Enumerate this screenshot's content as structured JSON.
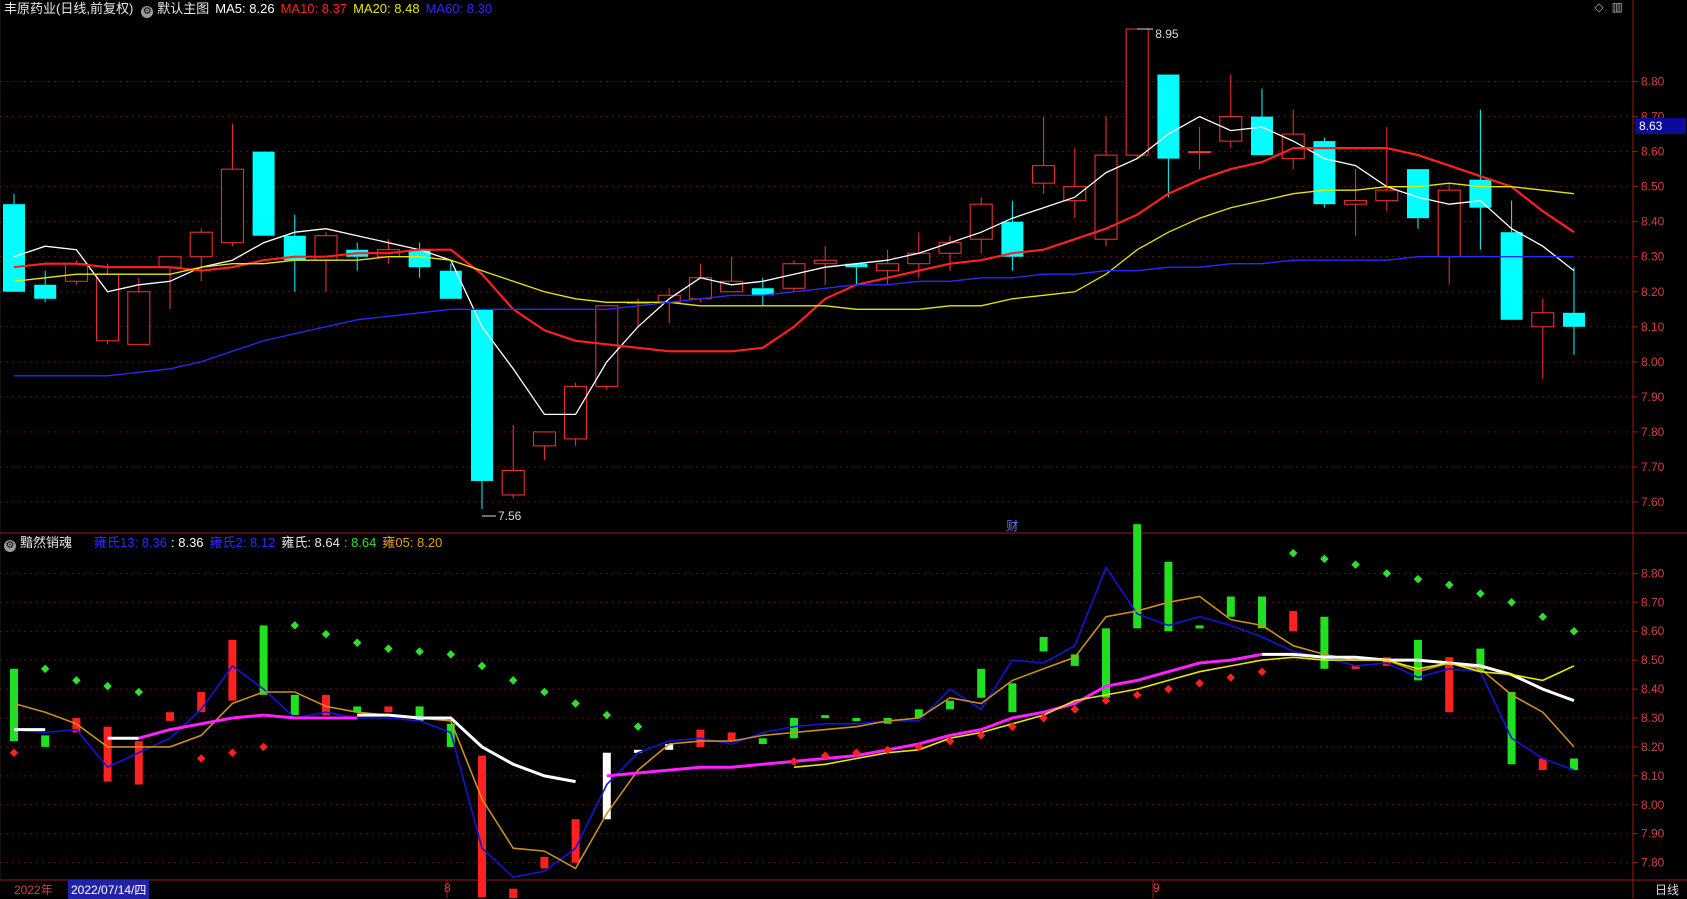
{
  "main_header": {
    "stock": "丰原药业(日线,前复权)",
    "chart_name": "默认主图",
    "ma5": "MA5: 8.26",
    "ma10": "MA10: 8.37",
    "ma20": "MA20: 8.48",
    "ma60": "MA60: 8.30",
    "colors": {
      "ma5": "#ffffff",
      "ma10": "#ff2020",
      "ma20": "#e6e600",
      "ma60": "#2a2aff"
    }
  },
  "sub_header": {
    "name": "黯然销魂",
    "l1": "雍氏13: 8.36",
    "l2": ": 8.36",
    "l3": "雍氏2: 8.12",
    "l4": "雍氏: 8.64",
    "l5": ": 8.64",
    "l6": "雍05: 8.20"
  },
  "current_price": "8.63",
  "fin_marker": "财",
  "bottom": {
    "year": "2022年",
    "date": "2022/07/14/四",
    "months": [
      "8",
      "9"
    ],
    "period": "日线"
  },
  "chart_data": [
    {
      "type": "candlestick",
      "title": "默认主图",
      "ylim": [
        7.52,
        8.97
      ],
      "y_ticks": [
        "8.80",
        "8.70",
        "8.60",
        "8.50",
        "8.40",
        "8.30",
        "8.20",
        "8.10",
        "8.00",
        "7.90",
        "7.80",
        "7.70",
        "7.60"
      ],
      "annotations": {
        "high": "8.95",
        "low": "7.56"
      },
      "candles": [
        [
          8.45,
          8.48,
          8.2,
          8.2
        ],
        [
          8.22,
          8.26,
          8.17,
          8.18
        ],
        [
          8.23,
          8.29,
          8.22,
          8.28
        ],
        [
          8.06,
          8.28,
          8.05,
          8.25
        ],
        [
          8.05,
          8.24,
          8.05,
          8.2
        ],
        [
          8.27,
          8.3,
          8.15,
          8.3
        ],
        [
          8.3,
          8.38,
          8.23,
          8.37
        ],
        [
          8.34,
          8.68,
          8.33,
          8.55
        ],
        [
          8.6,
          8.6,
          8.36,
          8.36
        ],
        [
          8.36,
          8.42,
          8.2,
          8.29
        ],
        [
          8.29,
          8.37,
          8.2,
          8.36
        ],
        [
          8.32,
          8.34,
          8.26,
          8.3
        ],
        [
          8.3,
          8.35,
          8.28,
          8.32
        ],
        [
          8.32,
          8.34,
          8.24,
          8.27
        ],
        [
          8.26,
          8.28,
          8.18,
          8.18
        ],
        [
          8.15,
          8.15,
          7.58,
          7.66
        ],
        [
          7.62,
          7.82,
          7.61,
          7.69
        ],
        [
          7.76,
          7.8,
          7.72,
          7.8
        ],
        [
          7.78,
          7.94,
          7.76,
          7.93
        ],
        [
          7.93,
          8.16,
          7.92,
          8.16
        ],
        [
          8.17,
          8.18,
          8.1,
          8.17
        ],
        [
          8.17,
          8.21,
          8.11,
          8.19
        ],
        [
          8.18,
          8.28,
          8.17,
          8.24
        ],
        [
          8.2,
          8.3,
          8.2,
          8.23
        ],
        [
          8.21,
          8.24,
          8.16,
          8.19
        ],
        [
          8.21,
          8.29,
          8.2,
          8.28
        ],
        [
          8.28,
          8.33,
          8.22,
          8.29
        ],
        [
          8.28,
          8.27,
          8.22,
          8.27
        ],
        [
          8.26,
          8.32,
          8.22,
          8.28
        ],
        [
          8.28,
          8.37,
          8.24,
          8.31
        ],
        [
          8.31,
          8.36,
          8.26,
          8.34
        ],
        [
          8.35,
          8.47,
          8.31,
          8.45
        ],
        [
          8.4,
          8.46,
          8.26,
          8.3
        ],
        [
          8.51,
          8.7,
          8.48,
          8.56
        ],
        [
          8.46,
          8.61,
          8.41,
          8.5
        ],
        [
          8.35,
          8.7,
          8.33,
          8.59
        ],
        [
          8.59,
          8.95,
          8.58,
          8.95
        ],
        [
          8.82,
          8.82,
          8.47,
          8.58
        ],
        [
          8.6,
          8.67,
          8.55,
          8.6
        ],
        [
          8.63,
          8.82,
          8.61,
          8.7
        ],
        [
          8.7,
          8.78,
          8.6,
          8.59
        ],
        [
          8.58,
          8.72,
          8.55,
          8.65
        ],
        [
          8.63,
          8.64,
          8.44,
          8.45
        ],
        [
          8.45,
          8.55,
          8.36,
          8.46
        ],
        [
          8.46,
          8.67,
          8.43,
          8.49
        ],
        [
          8.55,
          8.55,
          8.38,
          8.41
        ],
        [
          8.3,
          8.51,
          8.22,
          8.49
        ],
        [
          8.52,
          8.72,
          8.32,
          8.44
        ],
        [
          8.37,
          8.46,
          8.12,
          8.12
        ],
        [
          8.1,
          8.18,
          7.95,
          8.14
        ],
        [
          8.14,
          8.27,
          8.02,
          8.1
        ]
      ],
      "series": [
        {
          "name": "MA5",
          "color": "#ffffff",
          "values": [
            8.3,
            8.33,
            8.32,
            8.2,
            8.22,
            8.23,
            8.27,
            8.29,
            8.34,
            8.37,
            8.38,
            8.36,
            8.34,
            8.32,
            8.29,
            8.1,
            7.98,
            7.85,
            7.85,
            8.0,
            8.1,
            8.18,
            8.24,
            8.22,
            8.23,
            8.25,
            8.27,
            8.28,
            8.29,
            8.31,
            8.34,
            8.37,
            8.41,
            8.44,
            8.47,
            8.54,
            8.58,
            8.65,
            8.7,
            8.66,
            8.67,
            8.63,
            8.58,
            8.56,
            8.5,
            8.47,
            8.45,
            8.46,
            8.38,
            8.33,
            8.26
          ]
        },
        {
          "name": "MA10",
          "color": "#ff2020",
          "values": [
            8.27,
            8.28,
            8.28,
            8.27,
            8.27,
            8.27,
            8.26,
            8.27,
            8.29,
            8.3,
            8.3,
            8.31,
            8.31,
            8.32,
            8.32,
            8.25,
            8.15,
            8.09,
            8.06,
            8.05,
            8.04,
            8.03,
            8.03,
            8.03,
            8.04,
            8.1,
            8.18,
            8.22,
            8.24,
            8.26,
            8.28,
            8.29,
            8.31,
            8.32,
            8.35,
            8.38,
            8.42,
            8.48,
            8.52,
            8.55,
            8.57,
            8.61,
            8.61,
            8.61,
            8.61,
            8.59,
            8.56,
            8.53,
            8.5,
            8.43,
            8.37
          ]
        },
        {
          "name": "MA20",
          "color": "#e6e600",
          "values": [
            8.23,
            8.24,
            8.25,
            8.25,
            8.25,
            8.25,
            8.27,
            8.28,
            8.28,
            8.29,
            8.29,
            8.29,
            8.3,
            8.3,
            8.29,
            8.26,
            8.23,
            8.2,
            8.18,
            8.17,
            8.17,
            8.17,
            8.16,
            8.16,
            8.16,
            8.16,
            8.16,
            8.15,
            8.15,
            8.15,
            8.16,
            8.16,
            8.18,
            8.19,
            8.2,
            8.25,
            8.32,
            8.37,
            8.41,
            8.44,
            8.46,
            8.48,
            8.49,
            8.49,
            8.5,
            8.5,
            8.51,
            8.5,
            8.5,
            8.49,
            8.48
          ]
        },
        {
          "name": "MA60",
          "color": "#2a2aff",
          "values": [
            7.96,
            7.96,
            7.96,
            7.96,
            7.97,
            7.98,
            8.0,
            8.03,
            8.06,
            8.08,
            8.1,
            8.12,
            8.13,
            8.14,
            8.15,
            8.15,
            8.15,
            8.15,
            8.15,
            8.15,
            8.16,
            8.17,
            8.18,
            8.19,
            8.19,
            8.2,
            8.21,
            8.22,
            8.22,
            8.23,
            8.23,
            8.24,
            8.24,
            8.25,
            8.25,
            8.26,
            8.26,
            8.27,
            8.27,
            8.28,
            8.28,
            8.29,
            8.29,
            8.29,
            8.29,
            8.3,
            8.3,
            8.3,
            8.3,
            8.3,
            8.3
          ]
        }
      ]
    },
    {
      "type": "line",
      "title": "黯然销魂",
      "ylim": [
        7.74,
        8.86
      ],
      "y_ticks": [
        "8.80",
        "8.70",
        "8.60",
        "8.50",
        "8.40",
        "8.30",
        "8.20",
        "8.10",
        "8.00",
        "7.90",
        "7.80"
      ],
      "series": [
        {
          "name": "雍氏2",
          "color": "#1414d8",
          "values": [
            8.26,
            8.25,
            8.26,
            8.13,
            8.18,
            8.23,
            8.33,
            8.48,
            8.4,
            8.3,
            8.32,
            8.3,
            8.3,
            8.29,
            8.25,
            7.85,
            7.75,
            7.77,
            7.85,
            8.07,
            8.18,
            8.22,
            8.23,
            8.21,
            8.25,
            8.27,
            8.28,
            8.28,
            8.29,
            8.29,
            8.4,
            8.33,
            8.5,
            8.49,
            8.55,
            8.82,
            8.66,
            8.62,
            8.65,
            8.62,
            8.58,
            8.53,
            8.51,
            8.48,
            8.49,
            8.44,
            8.47,
            8.46,
            8.23,
            8.16,
            8.12
          ]
        },
        {
          "name": "雍氏",
          "color": "#c89020",
          "values": [
            8.35,
            8.32,
            8.28,
            8.2,
            8.2,
            8.2,
            8.24,
            8.35,
            8.39,
            8.39,
            8.34,
            8.32,
            8.31,
            8.3,
            8.29,
            8.02,
            7.85,
            7.84,
            7.78,
            7.97,
            8.12,
            8.21,
            8.22,
            8.22,
            8.24,
            8.25,
            8.26,
            8.27,
            8.29,
            8.3,
            8.37,
            8.35,
            8.43,
            8.47,
            8.51,
            8.65,
            8.67,
            8.7,
            8.72,
            8.64,
            8.62,
            8.55,
            8.52,
            8.5,
            8.5,
            8.46,
            8.49,
            8.47,
            8.38,
            8.32,
            8.2
          ]
        },
        {
          "name": "雍氏13",
          "color": "#ffffff",
          "values": [
            8.26,
            8.26,
            null,
            8.23,
            8.23,
            null,
            null,
            null,
            null,
            null,
            null,
            8.31,
            8.31,
            8.3,
            8.3,
            8.2,
            8.14,
            8.1,
            8.08,
            null,
            null,
            null,
            null,
            null,
            null,
            null,
            null,
            null,
            null,
            null,
            null,
            null,
            null,
            null,
            null,
            null,
            null,
            null,
            null,
            null,
            8.52,
            8.52,
            8.51,
            8.51,
            8.5,
            8.5,
            8.49,
            8.48,
            8.45,
            8.4,
            8.36
          ]
        },
        {
          "name": "magenta",
          "color": "#ff20ff",
          "values": [
            null,
            null,
            null,
            null,
            8.23,
            8.26,
            8.28,
            8.3,
            8.31,
            8.3,
            8.3,
            8.3,
            null,
            null,
            null,
            null,
            null,
            null,
            null,
            8.1,
            8.11,
            8.12,
            8.13,
            8.13,
            8.14,
            8.15,
            8.16,
            8.17,
            8.19,
            8.21,
            8.24,
            8.26,
            8.3,
            8.32,
            8.35,
            8.41,
            8.43,
            8.46,
            8.49,
            8.5,
            8.52,
            null,
            null,
            null,
            null,
            null,
            null,
            null,
            null,
            null,
            null
          ]
        },
        {
          "name": "雍05",
          "color": "#e6e600",
          "values": [
            null,
            null,
            null,
            null,
            null,
            null,
            null,
            null,
            null,
            null,
            null,
            null,
            null,
            null,
            null,
            null,
            null,
            null,
            null,
            null,
            null,
            null,
            null,
            null,
            null,
            8.13,
            8.14,
            8.16,
            8.18,
            8.19,
            8.23,
            8.25,
            8.28,
            8.31,
            8.36,
            8.38,
            8.4,
            8.43,
            8.46,
            8.48,
            8.5,
            8.51,
            8.5,
            8.5,
            8.5,
            8.47,
            8.49,
            8.46,
            8.45,
            8.43,
            8.48
          ]
        }
      ],
      "dots": [
        {
          "color": "#30e030",
          "values": [
            null,
            8.47,
            8.43,
            8.41,
            8.39,
            null,
            null,
            null,
            null,
            8.62,
            8.59,
            8.56,
            8.54,
            8.53,
            8.52,
            8.48,
            8.43,
            8.39,
            8.35,
            8.31,
            8.27,
            null,
            null,
            null,
            null,
            null,
            null,
            null,
            null,
            null,
            null,
            null,
            null,
            null,
            null,
            null,
            null,
            null,
            null,
            null,
            null,
            8.87,
            8.85,
            8.83,
            8.8,
            8.78,
            8.76,
            8.73,
            8.7,
            8.65,
            8.6
          ]
        },
        {
          "color": "#ff2020",
          "values": [
            8.18,
            null,
            null,
            null,
            null,
            null,
            8.16,
            8.18,
            8.2,
            null,
            null,
            null,
            null,
            null,
            null,
            null,
            null,
            null,
            null,
            null,
            null,
            null,
            null,
            null,
            null,
            8.15,
            8.17,
            8.18,
            8.19,
            8.2,
            8.22,
            8.24,
            8.27,
            8.3,
            8.33,
            8.36,
            8.38,
            8.4,
            8.42,
            8.44,
            8.46,
            null,
            null,
            null,
            null,
            null,
            null,
            null,
            null,
            null,
            null
          ]
        }
      ]
    }
  ]
}
